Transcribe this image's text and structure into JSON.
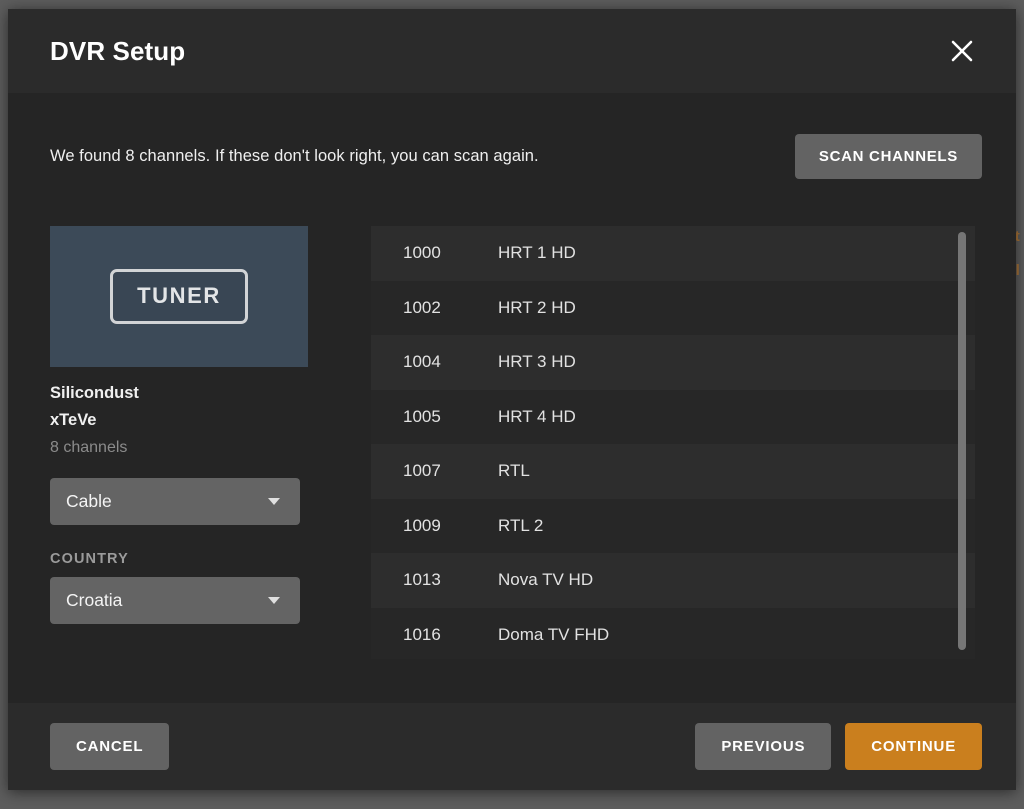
{
  "background": {
    "fragment_top": "st",
    "fragment_bottom": "el"
  },
  "modal": {
    "title": "DVR Setup",
    "close_icon": "close-icon",
    "intro_text": "We found 8 channels. If these don't look right, you can scan again.",
    "scan_button": "SCAN CHANNELS",
    "device": {
      "image_label": "TUNER",
      "brand": "Silicondust",
      "model": "xTeVe",
      "channel_count": "8 channels"
    },
    "source_select": {
      "value": "Cable",
      "caret_icon": "chevron-down-icon"
    },
    "country_field": {
      "label": "COUNTRY",
      "value": "Croatia",
      "caret_icon": "chevron-down-icon"
    },
    "channels": [
      {
        "number": "1000",
        "name": "HRT 1 HD"
      },
      {
        "number": "1002",
        "name": "HRT 2 HD"
      },
      {
        "number": "1004",
        "name": "HRT 3 HD"
      },
      {
        "number": "1005",
        "name": "HRT 4 HD"
      },
      {
        "number": "1007",
        "name": "RTL"
      },
      {
        "number": "1009",
        "name": "RTL 2"
      },
      {
        "number": "1013",
        "name": "Nova TV HD"
      },
      {
        "number": "1016",
        "name": "Doma TV FHD"
      }
    ],
    "footer": {
      "cancel": "CANCEL",
      "previous": "PREVIOUS",
      "continue": "CONTINUE"
    }
  },
  "colors": {
    "accent": "#ca7f1e",
    "modal_bg": "#252525",
    "header_bg": "#2b2b2b",
    "button_grey": "#636363",
    "tuner_bg": "#3c4a58",
    "page_bg": "#5b5b5b"
  }
}
